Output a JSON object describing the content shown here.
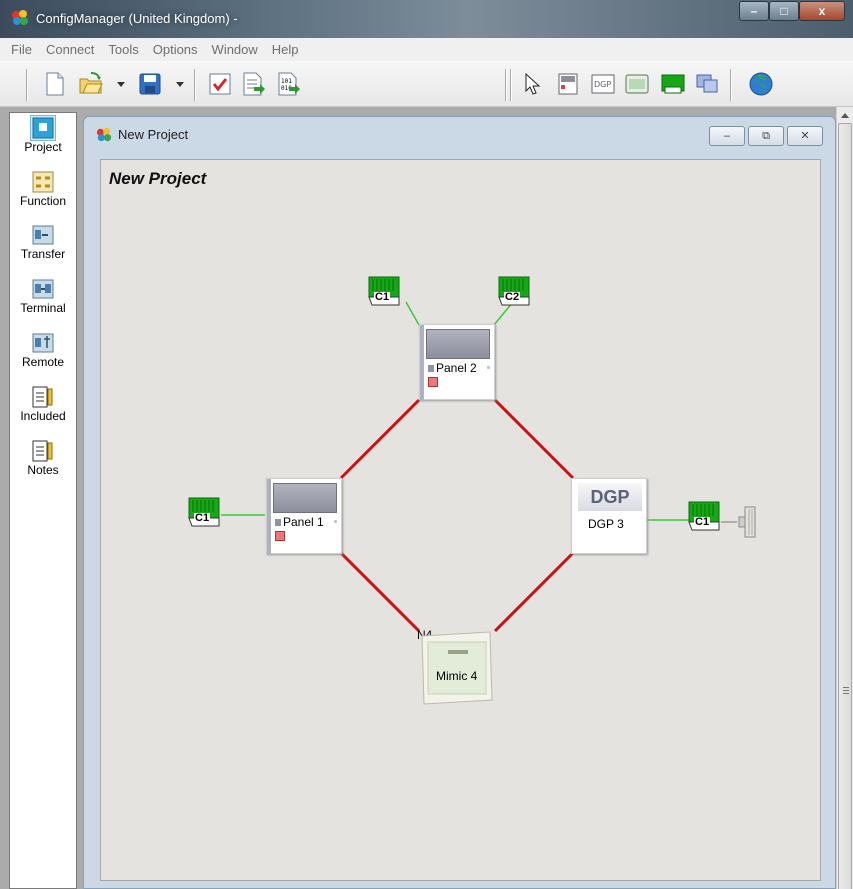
{
  "window": {
    "title": "ConfigManager (United Kingdom) -",
    "min_label": "–",
    "max_label": "□",
    "close_label": "x"
  },
  "menu": [
    "File",
    "Connect",
    "Tools",
    "Options",
    "Window",
    "Help"
  ],
  "palette": [
    {
      "label": "Project",
      "icon": "project-icon"
    },
    {
      "label": "Function",
      "icon": "function-icon"
    },
    {
      "label": "Transfer",
      "icon": "transfer-icon"
    },
    {
      "label": "Terminal",
      "icon": "terminal-icon"
    },
    {
      "label": "Remote",
      "icon": "remote-icon"
    },
    {
      "label": "Included",
      "icon": "included-icon"
    },
    {
      "label": "Notes",
      "icon": "notes-icon"
    }
  ],
  "child": {
    "title": "New Project",
    "project_title": "New Project",
    "min_label": "–",
    "restore_label": "⧉",
    "close_label": "✕"
  },
  "nodes": {
    "n1": {
      "id": "N1",
      "label": "Panel 1"
    },
    "n2": {
      "id": "N2",
      "label": "Panel 2"
    },
    "n3": {
      "id": "N3",
      "label": "DGP 3",
      "badge": "DGP"
    },
    "n4": {
      "id": "N4",
      "label": "Mimic 4"
    }
  },
  "cards": {
    "n1_c1": "C1",
    "n2_c1": "C1",
    "n2_c2": "C2",
    "n3_c1": "C1"
  },
  "colors": {
    "network_link": "#cc1111",
    "card_link": "#3ac83a",
    "card_green": "#17a817"
  }
}
